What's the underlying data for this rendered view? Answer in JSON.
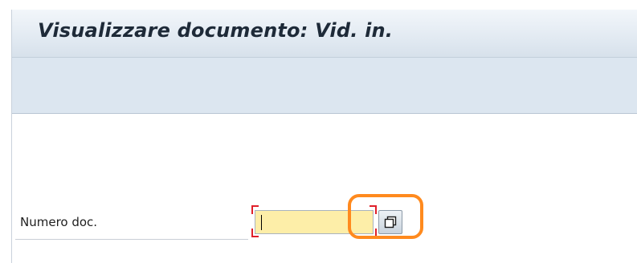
{
  "window": {
    "title": "Visualizzare documento: Vid. in."
  },
  "form": {
    "doc_number": {
      "label": "Numero doc.",
      "value": "",
      "state": "required, focused"
    },
    "value_help": {
      "icon": "value-help-icon"
    }
  },
  "colors": {
    "title_text": "#1e2a38",
    "toolbar_bg": "#dce6f0",
    "input_bg": "#fdeea8",
    "required_marker": "#e0202a",
    "highlight_ring": "#ff8a1e"
  }
}
